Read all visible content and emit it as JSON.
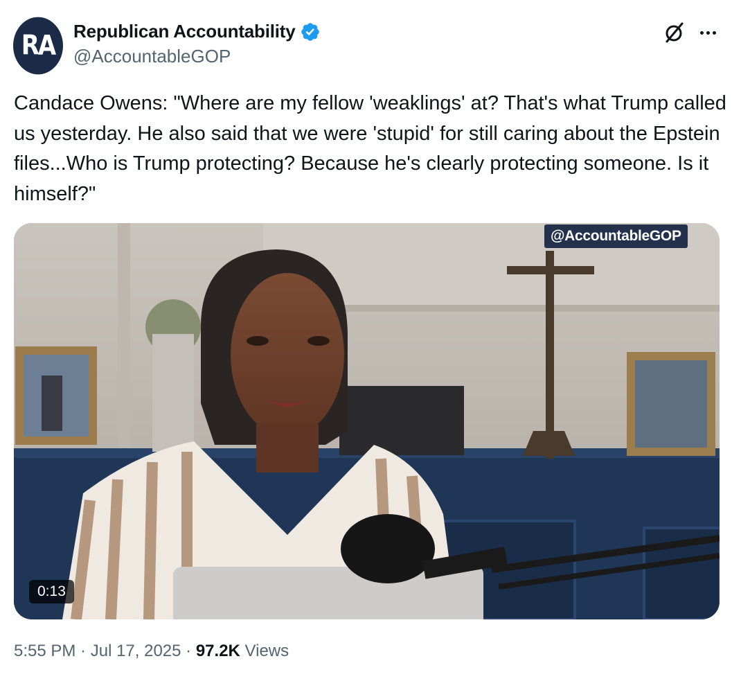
{
  "author": {
    "avatar_initials": "RA",
    "avatar_color": "#1b2a47",
    "display_name": "Republican Accountability",
    "handle": "@AccountableGOP",
    "verified": true,
    "verified_color": "#1d9bf0"
  },
  "header_actions": {
    "grok_icon": "grok-slash-circle-icon",
    "more_icon": "more-horizontal-icon"
  },
  "tweet": {
    "text": "Candace Owens: \"Where are my fellow 'weaklings' at? That's what Trump called us yesterday. He also said that we were 'stupid' for still caring about the Epstein files...Who is Trump protecting? Because he's clearly protecting someone. Is it himself?\""
  },
  "media": {
    "type": "video",
    "watermark": "@AccountableGOP",
    "duration": "0:13"
  },
  "meta": {
    "time": "5:55 PM",
    "separator": " · ",
    "date": "Jul 17, 2025",
    "views_count": "97.2K",
    "views_label": " Views"
  }
}
